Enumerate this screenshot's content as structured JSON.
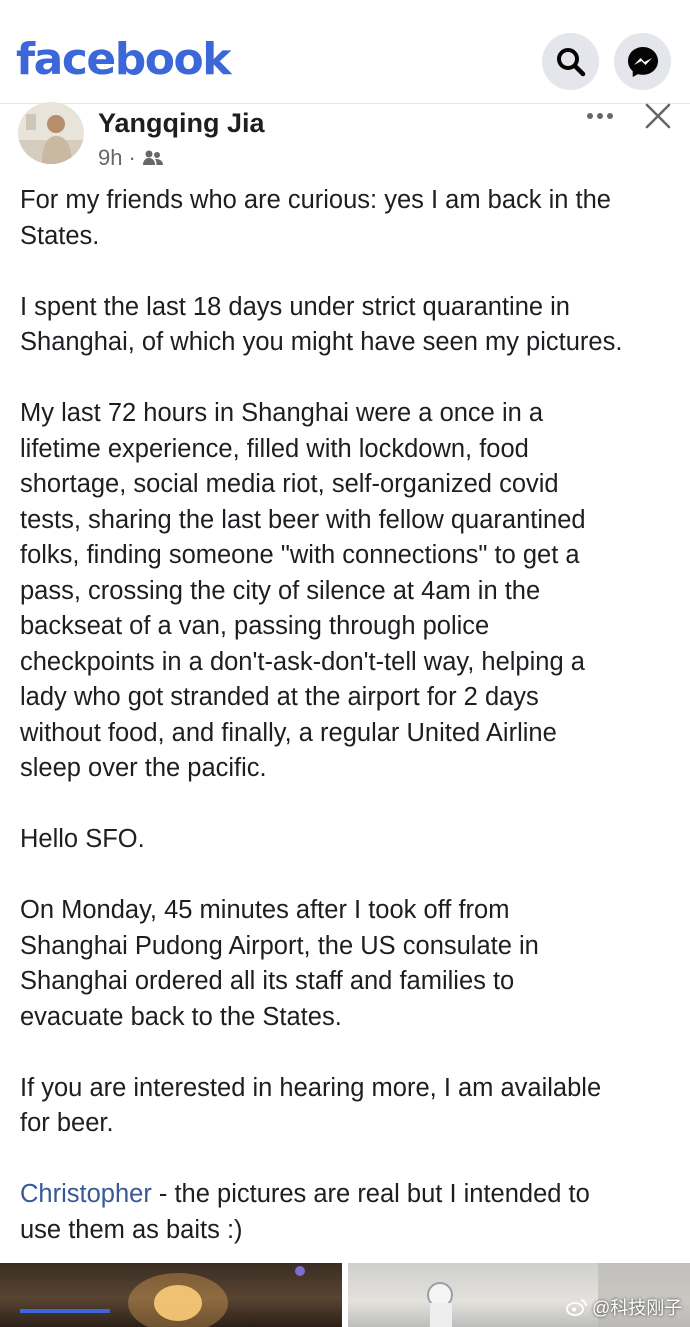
{
  "header": {
    "logo": "facebook",
    "search_icon": "search-icon",
    "messenger_icon": "messenger-icon",
    "brand_color": "#3b67d8"
  },
  "post": {
    "author": "Yangqing Jia",
    "time": "9h",
    "audience_icon": "friends-icon",
    "paragraphs": [
      "For my friends who are curious: yes I am back in the\nStates.",
      "I spent the last 18 days under strict quarantine in\nShanghai, of which you might have seen my pictures.",
      "My last 72 hours in Shanghai were a once in a\nlifetime experience, filled with lockdown, food\nshortage, social media riot, self-organized covid\ntests, sharing the last beer with fellow quarantined\nfolks, finding someone \"with connections\" to get a\npass, crossing the city of silence at 4am in the\nbackseat of a van, passing through police\ncheckpoints in a don't-ask-don't-tell way, helping a\nlady who got stranded at the airport for 2 days\nwithout food, and finally, a regular United Airline\nsleep over the pacific.",
      "Hello SFO.",
      "On Monday, 45 minutes after I took off from\nShanghai Pudong Airport, the US consulate in\nShanghai ordered all its staff and families to\nevacuate back to the States.",
      "If you are interested in hearing more, I am available\nfor beer."
    ],
    "mention": "Christopher",
    "mention_text": " - the pictures are real but I intended to\nuse them as baits :)",
    "link_color": "#385898"
  },
  "watermark": {
    "text": "@科技刚子",
    "icon": "weibo-icon"
  }
}
